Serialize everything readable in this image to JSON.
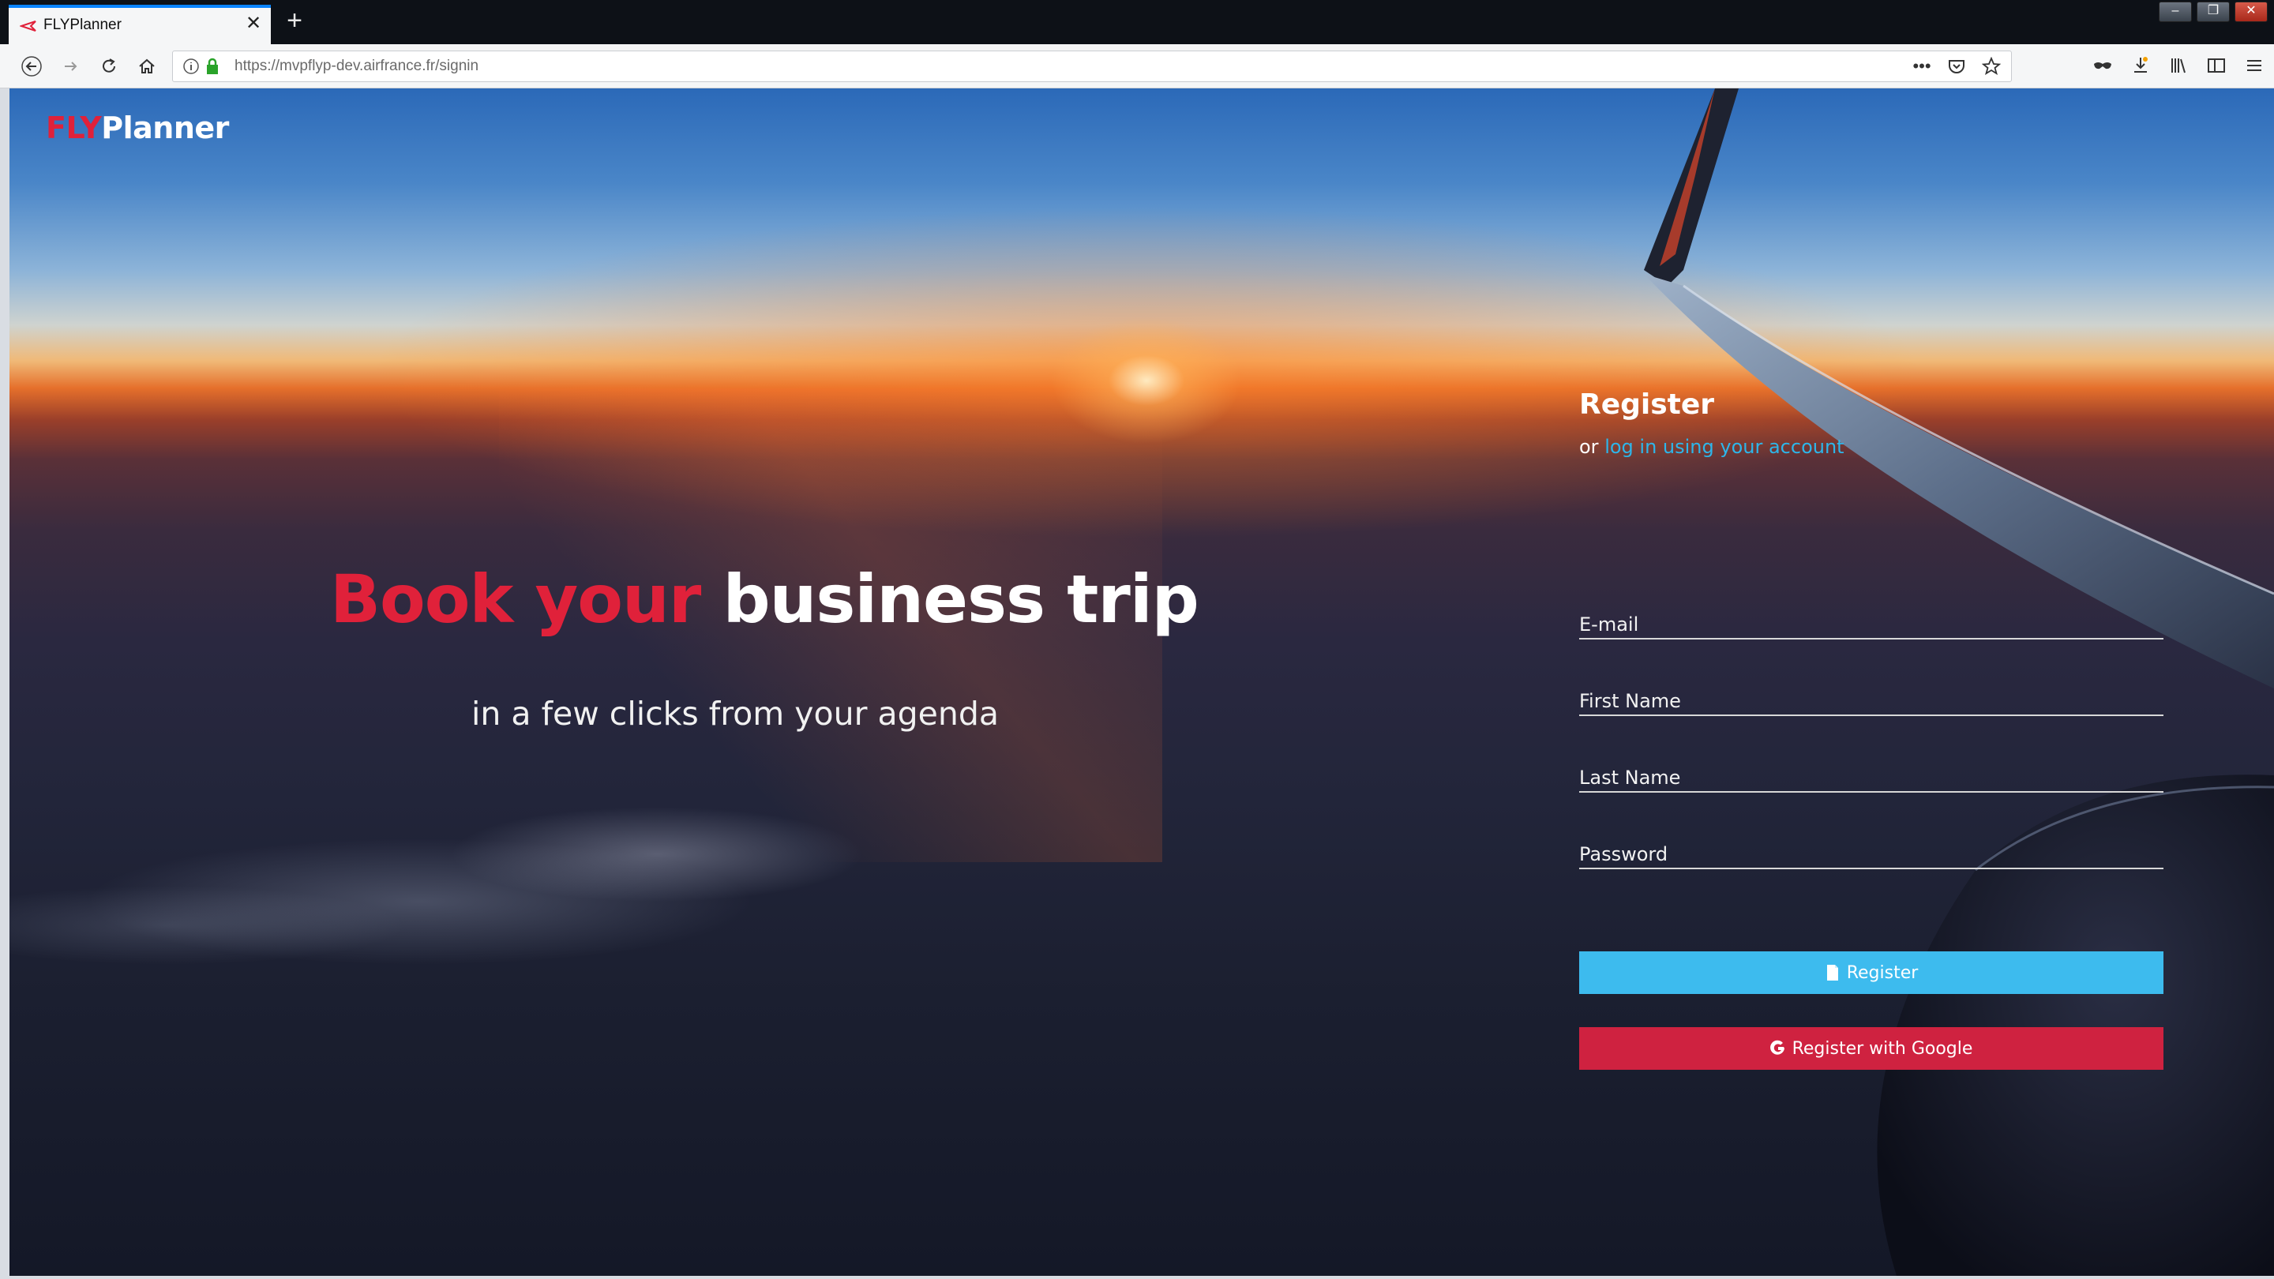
{
  "browser": {
    "tab_title": "FLYPlanner",
    "url": "https://mvpflyp-dev.airfrance.fr/signin",
    "toolbar_icons": [
      "back-icon",
      "forward-icon",
      "reload-icon",
      "home-icon",
      "page-actions-icon",
      "pocket-icon",
      "bookmark-star-icon",
      "extension-mask-icon",
      "download-icon",
      "library-icon",
      "sidebar-icon",
      "menu-icon"
    ],
    "window_controls": [
      "minimize",
      "restore",
      "close"
    ]
  },
  "brand": {
    "fly": "FLY",
    "planner": "Planner",
    "red": "#e0213a"
  },
  "hero": {
    "title_red": "Book your",
    "title_white": "business trip",
    "subtitle": "in a few clicks from your agenda"
  },
  "form": {
    "title": "Register",
    "login_prefix": "or",
    "login_link": "log in using your account",
    "email_placeholder": "E-mail",
    "first_name_placeholder": "First Name",
    "last_name_placeholder": "Last Name",
    "password_placeholder": "Password",
    "register_button": "Register",
    "google_button": "Register with Google",
    "register_color": "#3dbbee",
    "google_color": "#cf2240"
  }
}
